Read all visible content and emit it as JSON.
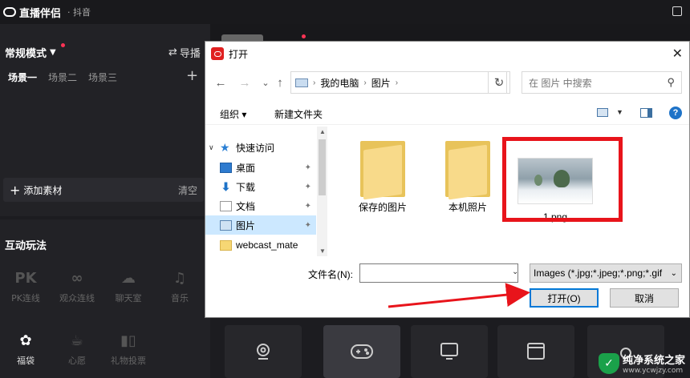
{
  "app": {
    "title": "直播伴侣",
    "subtitle": "· 抖音"
  },
  "left": {
    "mode_label": "常规模式",
    "guide_label": "导播",
    "scenes": [
      "场景一",
      "场景二",
      "场景三"
    ],
    "add_material": "添加素材",
    "clear": "清空",
    "interact_title": "互动玩法",
    "tools": [
      {
        "icon": "PK",
        "label": "PK连线"
      },
      {
        "icon": "∞",
        "label": "观众连线"
      },
      {
        "icon": "☁",
        "label": "聊天室"
      },
      {
        "icon": "♫",
        "label": "音乐"
      },
      {
        "icon": "✿",
        "label": "福袋"
      },
      {
        "icon": "☕",
        "label": "心愿"
      },
      {
        "icon": "▮▯",
        "label": "礼物投票"
      }
    ]
  },
  "dialog": {
    "title": "打开",
    "close": "✕",
    "nav": {
      "back": "←",
      "forward": "→",
      "recent": "⌄",
      "up": "↑",
      "refresh": "↻"
    },
    "address": [
      "我的电脑",
      "图片"
    ],
    "search_placeholder": "在 图片 中搜索",
    "commands": {
      "organize": "组织 ▾",
      "new_folder": "新建文件夹",
      "help": "?"
    },
    "tree": [
      {
        "label": "快速访问",
        "icon": "star",
        "expandable": true
      },
      {
        "label": "桌面",
        "icon": "desktop",
        "pinned": true
      },
      {
        "label": "下载",
        "icon": "download",
        "pinned": true
      },
      {
        "label": "文档",
        "icon": "document",
        "pinned": true
      },
      {
        "label": "图片",
        "icon": "pictures",
        "pinned": true,
        "selected": true
      },
      {
        "label": "webcast_mate",
        "icon": "folder"
      }
    ],
    "files": [
      {
        "name": "保存的图片",
        "kind": "folder"
      },
      {
        "name": "本机照片",
        "kind": "folder"
      },
      {
        "name": "1.png",
        "kind": "image"
      }
    ],
    "filename_label": "文件名(N):",
    "filename_value": "",
    "filetype": "Images (*.jpg;*.jpeg;*.png;*.gif",
    "open_button": "打开(O)",
    "cancel_button": "取消"
  },
  "watermark": {
    "title": "纯净系统之家",
    "url": "www.ycwjzy.com"
  },
  "colors": {
    "accent_red": "#e8141b",
    "selection": "#cce8ff",
    "primary_border": "#0078d7"
  }
}
